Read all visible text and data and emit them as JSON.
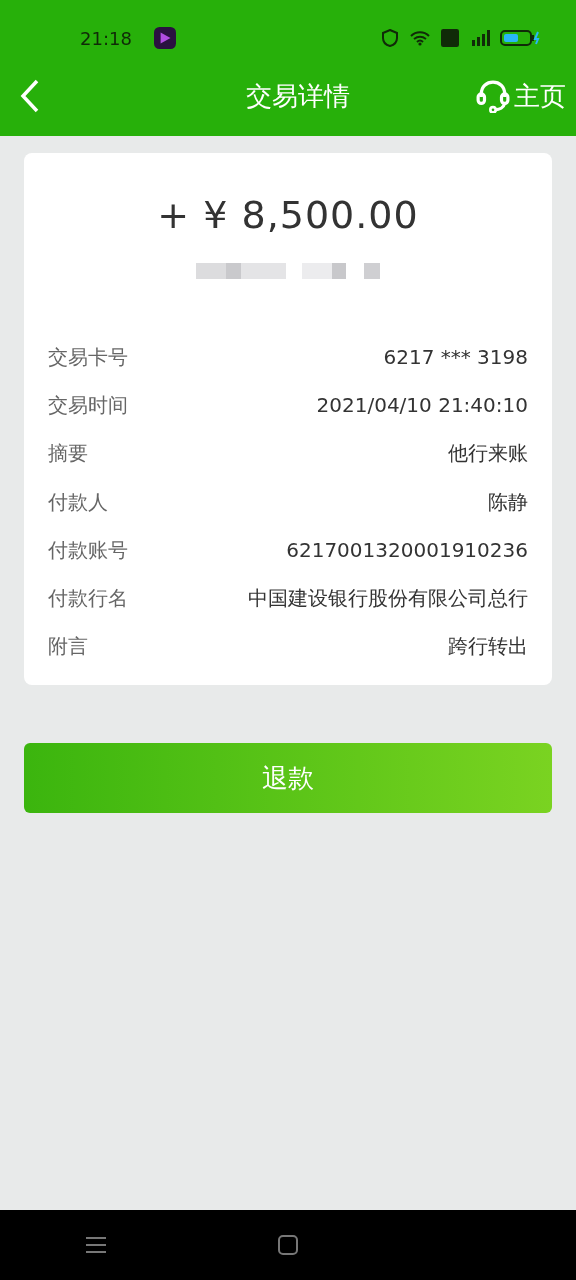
{
  "status_bar": {
    "time": "21:18"
  },
  "header": {
    "title": "交易详情",
    "home": "主页"
  },
  "amount": "+ ¥ 8,500.00",
  "details": [
    {
      "label": "交易卡号",
      "value": "6217 *** 3198"
    },
    {
      "label": "交易时间",
      "value": "2021/04/10 21:40:10"
    },
    {
      "label": "摘要",
      "value": "他行来账"
    },
    {
      "label": "付款人",
      "value": "陈静"
    },
    {
      "label": "付款账号",
      "value": "6217001320001910236"
    },
    {
      "label": "付款行名",
      "value": "中国建设银行股份有限公司总行"
    },
    {
      "label": "附言",
      "value": "跨行转出"
    }
  ],
  "refund_button": "退款"
}
